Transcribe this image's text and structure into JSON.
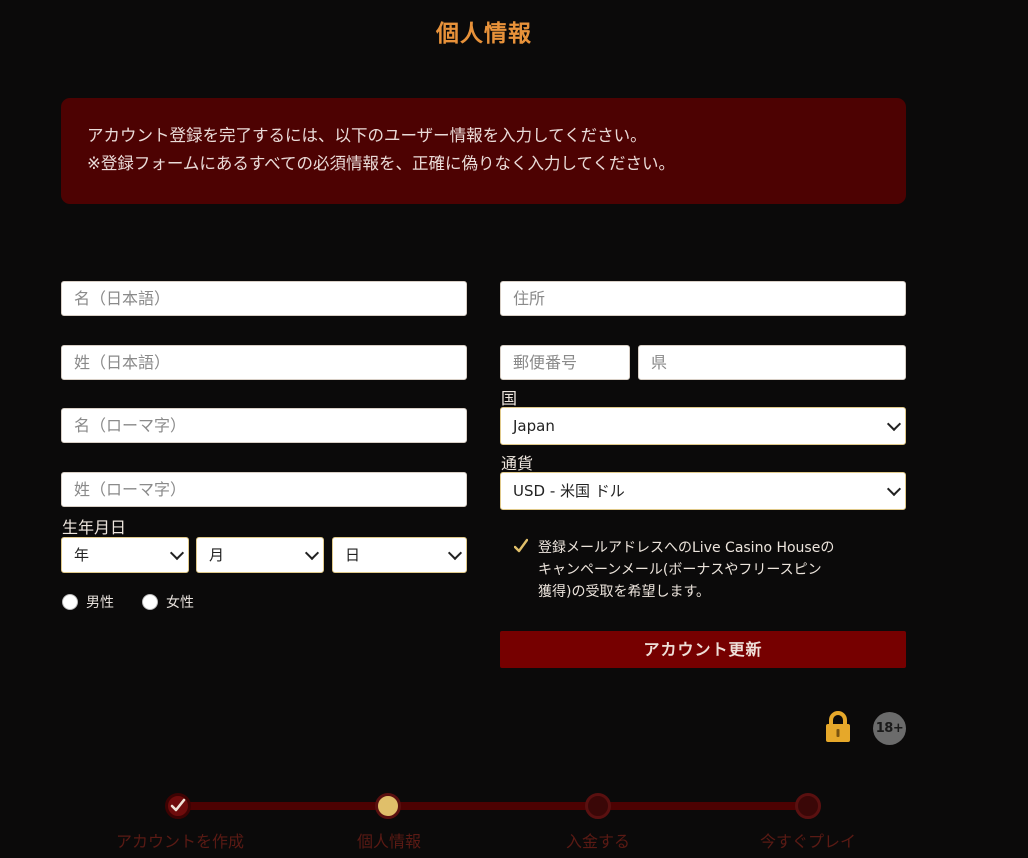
{
  "page": {
    "title": "個人情報"
  },
  "notice": {
    "line1": "アカウント登録を完了するには、以下のユーザー情報を入力してください。",
    "line2": "※登録フォームにあるすべての必須情報を、正確に偽りなく入力してください。"
  },
  "form": {
    "first_name_jp_placeholder": "名（日本語）",
    "last_name_jp_placeholder": "姓（日本語）",
    "first_name_roman_placeholder": "名（ローマ字）",
    "last_name_roman_placeholder": "姓（ローマ字）",
    "birthdate_label": "生年月日",
    "year_placeholder": "年",
    "month_placeholder": "月",
    "day_placeholder": "日",
    "gender_male": "男性",
    "gender_female": "女性",
    "address_placeholder": "住所",
    "postal_code_placeholder": "郵便番号",
    "prefecture_placeholder": "県",
    "country_label": "国",
    "country_value": "Japan",
    "currency_label": "通貨",
    "currency_value": "USD - 米国 ドル",
    "newsletter_line1": "登録メールアドレスへのLive Casino Houseの",
    "newsletter_line2": "キャンペーンメール(ボーナスやフリースピン",
    "newsletter_line3": "獲得)の受取を希望します。",
    "newsletter_checked": true,
    "submit_label": "アカウント更新"
  },
  "badges": {
    "age_label": "18+"
  },
  "steps": [
    {
      "label": "アカウントを作成",
      "state": "done"
    },
    {
      "label": "個人情報",
      "state": "current"
    },
    {
      "label": "入金する",
      "state": "pending"
    },
    {
      "label": "今すぐプレイ",
      "state": "pending"
    }
  ],
  "colors": {
    "background": "#0b0a0a",
    "accent_orange": "#e8923a",
    "notice_bg": "#4d0202",
    "button_bg": "#760000",
    "gold": "#e0bf6a",
    "step_done": "#6e0c0c",
    "step_current": "#e0bf6a",
    "step_pending": "#5a1010"
  }
}
